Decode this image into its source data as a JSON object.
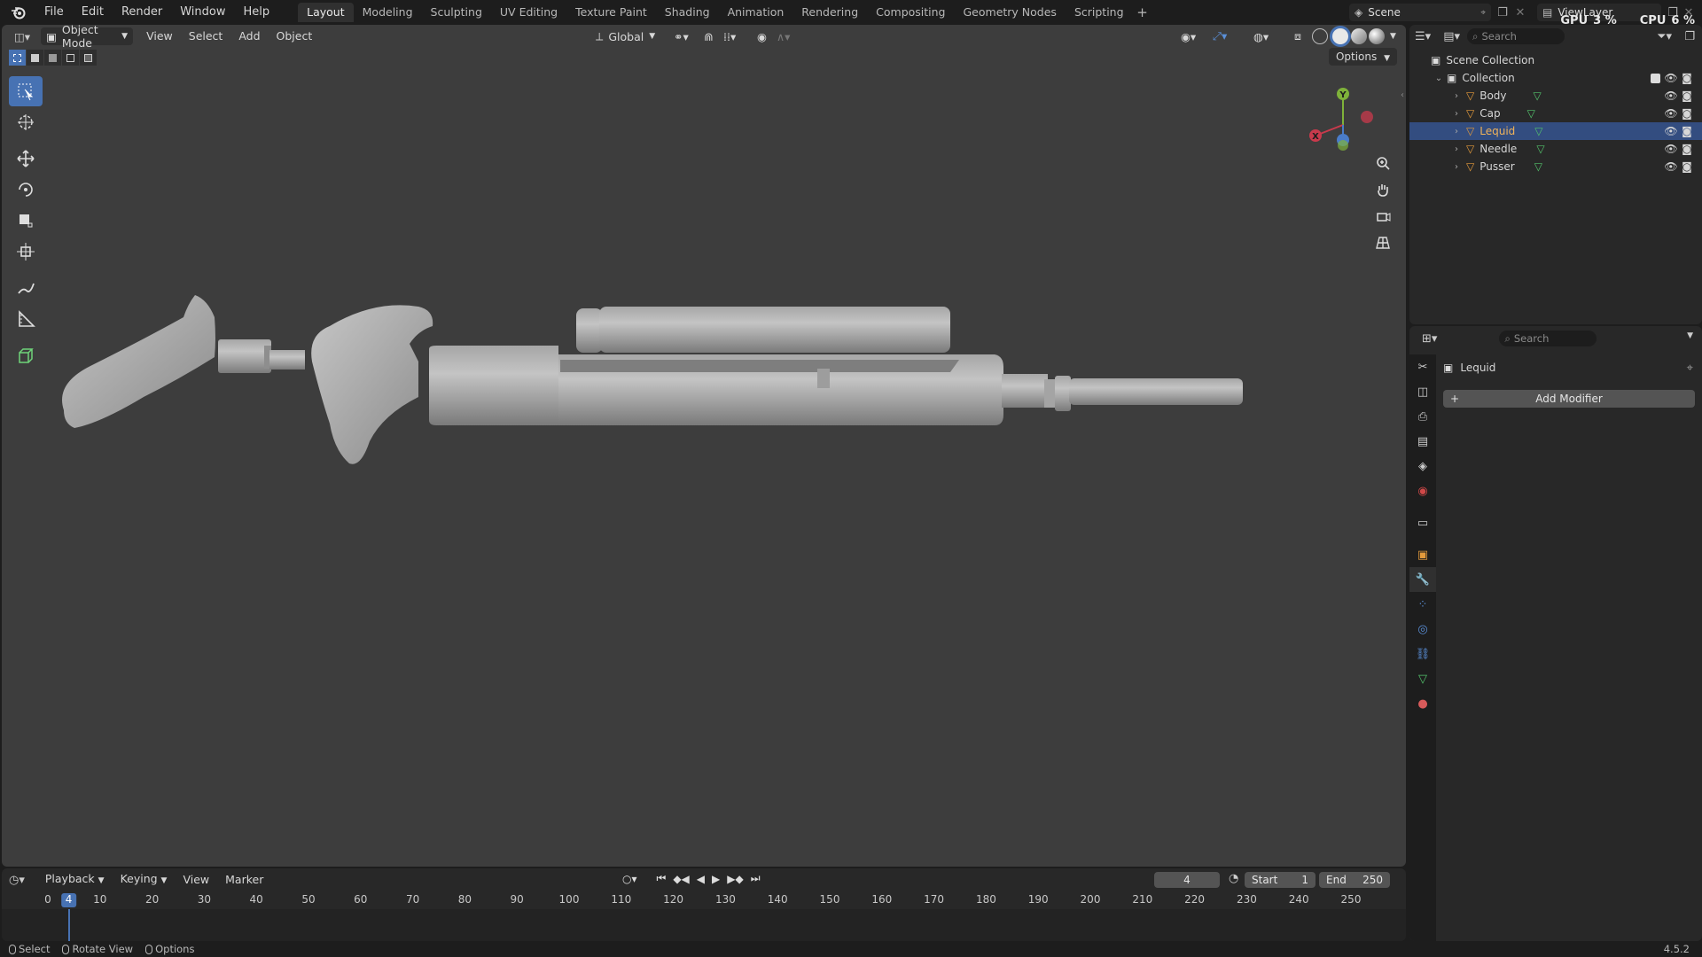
{
  "topbar": {
    "menus": [
      "File",
      "Edit",
      "Render",
      "Window",
      "Help"
    ],
    "workspaces": [
      "Layout",
      "Modeling",
      "Sculpting",
      "UV Editing",
      "Texture Paint",
      "Shading",
      "Animation",
      "Rendering",
      "Compositing",
      "Geometry Nodes",
      "Scripting"
    ],
    "active_workspace": "Layout",
    "add_workspace": "+",
    "scene": "Scene",
    "view_layer": "ViewLayer",
    "gpu_label": "GPU",
    "gpu_value": "3 %",
    "cpu_label": "CPU",
    "cpu_value": "6 %"
  },
  "viewport": {
    "mode": "Object Mode",
    "menus": [
      "View",
      "Select",
      "Add",
      "Object"
    ],
    "orientation": "Global",
    "options_label": "Options",
    "gizmo": {
      "x": "X",
      "y": "Y",
      "z": "Z"
    }
  },
  "outliner": {
    "search_placeholder": "Search",
    "root": "Scene Collection",
    "collection": "Collection",
    "objects": [
      {
        "name": "Body",
        "selected": false
      },
      {
        "name": "Cap",
        "selected": false
      },
      {
        "name": "Lequid",
        "selected": true
      },
      {
        "name": "Needle",
        "selected": false
      },
      {
        "name": "Pusser",
        "selected": false
      }
    ]
  },
  "properties": {
    "search_placeholder": "Search",
    "object_name": "Lequid",
    "add_modifier": "Add Modifier"
  },
  "timeline": {
    "menus": [
      "Playback",
      "Keying",
      "View",
      "Marker"
    ],
    "current_frame": "4",
    "start_label": "Start",
    "start_value": "1",
    "end_label": "End",
    "end_value": "250",
    "ticks": [
      "0",
      "10",
      "20",
      "30",
      "40",
      "50",
      "60",
      "70",
      "80",
      "90",
      "100",
      "110",
      "120",
      "130",
      "140",
      "150",
      "160",
      "170",
      "180",
      "190",
      "200",
      "210",
      "220",
      "230",
      "240",
      "250"
    ]
  },
  "statusbar": {
    "select": "Select",
    "rotate_view": "Rotate View",
    "options": "Options",
    "version": "4.5.2"
  },
  "colors": {
    "accent": "#4772b3",
    "selected_row": "#334d80",
    "object_icon": "#e39a3b",
    "mesh_icon": "#53c26b",
    "viewport_bg": "#3d3d3d"
  }
}
